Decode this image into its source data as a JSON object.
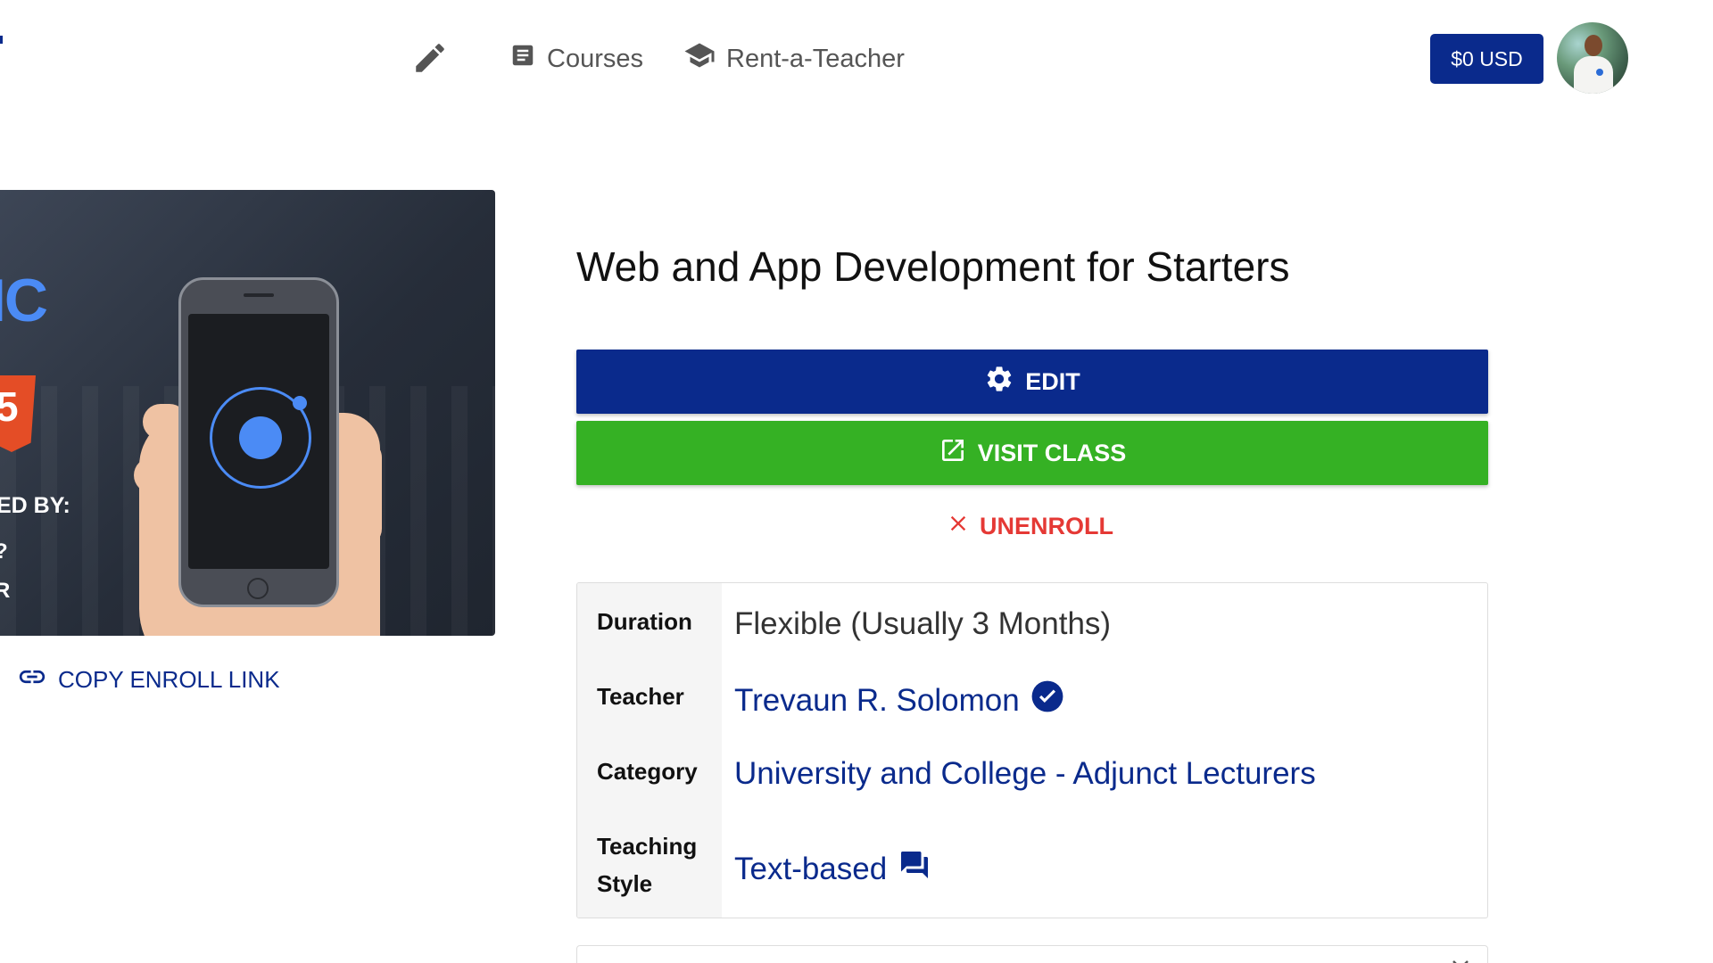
{
  "header": {
    "nav": {
      "courses_label": "Courses",
      "rent_label": "Rent-a-Teacher"
    },
    "wallet_label": "$0 USD"
  },
  "banner": {
    "brand_fragment": "IC",
    "html5_fragment": "5",
    "by_fragment": "ED BY:",
    "line_fragment_1": "?",
    "line_fragment_2": "R"
  },
  "sidebar": {
    "copy_enroll_label": "COPY ENROLL LINK"
  },
  "course": {
    "title": "Web and App Development for Starters",
    "actions": {
      "edit_label": "EDIT",
      "visit_label": "VISIT CLASS",
      "unenroll_label": "UNENROLL"
    },
    "details": {
      "duration_label": "Duration",
      "duration_value": "Flexible (Usually 3 Months)",
      "teacher_label": "Teacher",
      "teacher_value": "Trevaun R. Solomon",
      "category_label": "Category",
      "category_value": "University and College - Adjunct Lecturers",
      "style_label_1": "Teaching",
      "style_label_2": "Style",
      "style_value": "Text-based"
    }
  },
  "colors": {
    "primary": "#0a2a8c",
    "success": "#35b124",
    "danger": "#e53935",
    "brand_blue": "#4b8bf5"
  },
  "icons": {
    "nav_edit": "pencil-icon",
    "courses": "document-icon",
    "rent": "graduation-cap-icon",
    "edit": "gear-icon",
    "visit": "external-link-icon",
    "unenroll": "close-icon",
    "copy": "link-icon",
    "verified": "check-circle-icon",
    "style": "chat-bubbles-icon",
    "expand": "chevron-down-icon"
  }
}
